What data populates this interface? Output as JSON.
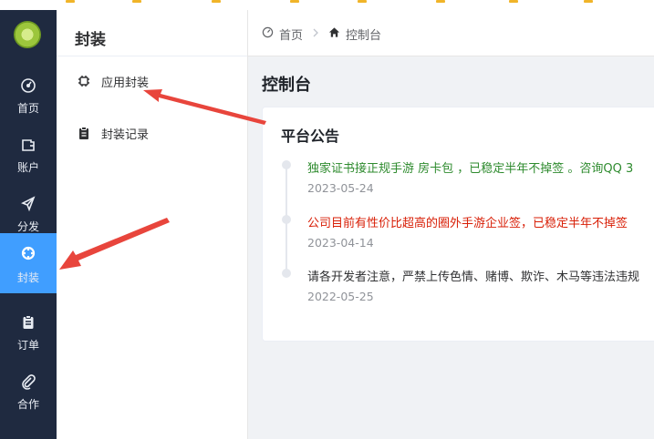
{
  "rail": {
    "items": [
      {
        "label": "首页",
        "icon": "dashboard-icon"
      },
      {
        "label": "账户",
        "icon": "wallet-icon"
      },
      {
        "label": "分发",
        "icon": "send-icon"
      },
      {
        "label": "封装",
        "icon": "package-icon",
        "active": true
      },
      {
        "label": "订单",
        "icon": "clipboard-icon"
      },
      {
        "label": "合作",
        "icon": "paperclip-icon"
      }
    ]
  },
  "submenu": {
    "title": "封装",
    "items": [
      {
        "label": "应用封装",
        "icon": "chip-icon"
      },
      {
        "label": "封装记录",
        "icon": "clipboard-icon"
      }
    ]
  },
  "breadcrumb": {
    "home": "首页",
    "current": "控制台"
  },
  "page": {
    "title": "控制台"
  },
  "announcements": {
    "title": "平台公告",
    "items": [
      {
        "text": "独家证书接正规手游 房卡包 ，已稳定半年不掉签 。咨询QQ 3",
        "date": "2023-05-24",
        "color": "#2e8b2e"
      },
      {
        "text": "公司目前有性价比超高的圈外手游企业签，已稳定半年不掉签",
        "date": "2023-04-14",
        "color": "#d81e06"
      },
      {
        "text": "请各开发者注意，严禁上传色情、赌博、欺诈、木马等违法违规",
        "date": "2022-05-25",
        "color": "#303133"
      }
    ]
  },
  "colors": {
    "rail_bg": "#1f2a40",
    "active": "#409eff",
    "arrow": "#e8453c"
  }
}
